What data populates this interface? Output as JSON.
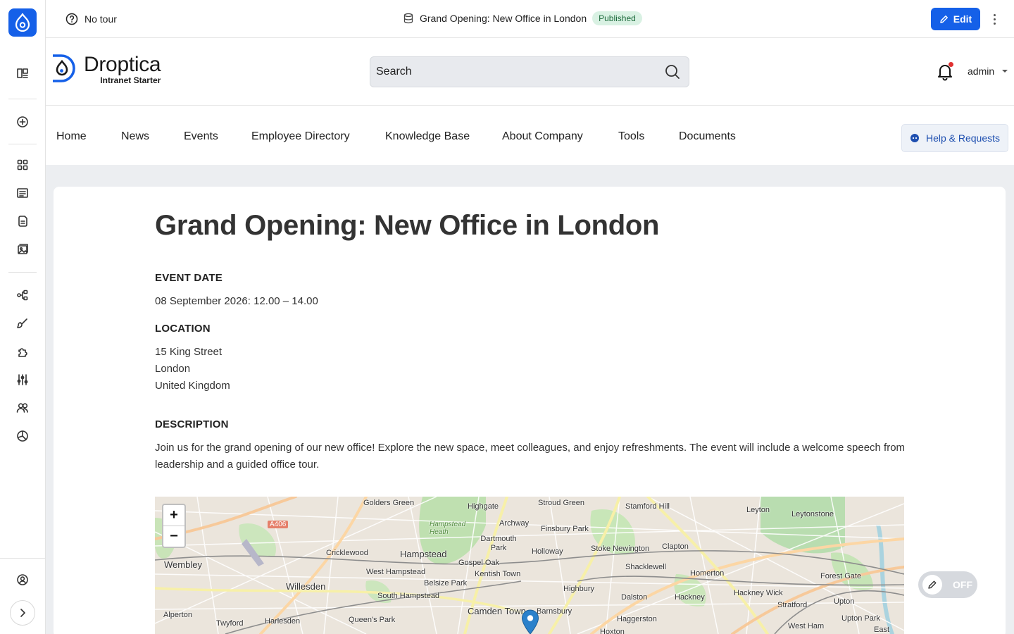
{
  "topbar": {
    "tour_label": "No tour",
    "page_title": "Grand Opening: New Office in London",
    "status_badge": "Published",
    "edit_label": "Edit"
  },
  "header": {
    "brand_name": "Droptica",
    "brand_subtitle": "Intranet Starter",
    "search_placeholder": "Search",
    "user_name": "admin"
  },
  "nav": {
    "items": [
      "Home",
      "News",
      "Events",
      "Employee Directory",
      "Knowledge Base",
      "About Company",
      "Tools",
      "Documents"
    ],
    "help_label": "Help & Requests"
  },
  "event": {
    "title": "Grand Opening: New Office in London",
    "date_label": "EVENT DATE",
    "date_value": "08 September 2026: 12.00 – 14.00",
    "location_label": "LOCATION",
    "location_lines": [
      "15 King Street",
      "London",
      "United Kingdom"
    ],
    "description_label": "DESCRIPTION",
    "description": "Join us for the grand opening of our new office! Explore the new space, meet colleagues, and enjoy refreshments. The event will include a welcome speech from leadership and a guided office tour."
  },
  "map": {
    "zoom_in": "+",
    "zoom_out": "−",
    "road_label": "A406",
    "places": [
      "Golders Green",
      "Highgate",
      "Stroud Green",
      "Stamford Hill",
      "Leyton",
      "Leytonstone",
      "Hampstead Heath",
      "Archway",
      "Finsbury Park",
      "Dartmouth Park",
      "Holloway",
      "Stoke Newington",
      "Clapton",
      "Cricklewood",
      "Hampstead",
      "Wembley",
      "Gospel Oak",
      "West Hampstead",
      "Kentish Town",
      "Shacklewell",
      "Homerton",
      "Forest Gate",
      "Belsize Park",
      "Willesden",
      "Highbury",
      "Hackney",
      "Hackney Wick",
      "South Hampstead",
      "Dalston",
      "Stratford",
      "Upton",
      "Camden Town",
      "Barnsbury",
      "Alperton",
      "Twyford",
      "Harlesden",
      "Queen's Park",
      "Haggerston",
      "Upton Park",
      "West Ham",
      "Hoxton",
      "East"
    ]
  },
  "toggle": {
    "label": "OFF"
  },
  "colors": {
    "accent": "#1560e8",
    "badge_bg": "#d9f1e3",
    "badge_text": "#1d6b3c",
    "notification": "#e03131"
  }
}
